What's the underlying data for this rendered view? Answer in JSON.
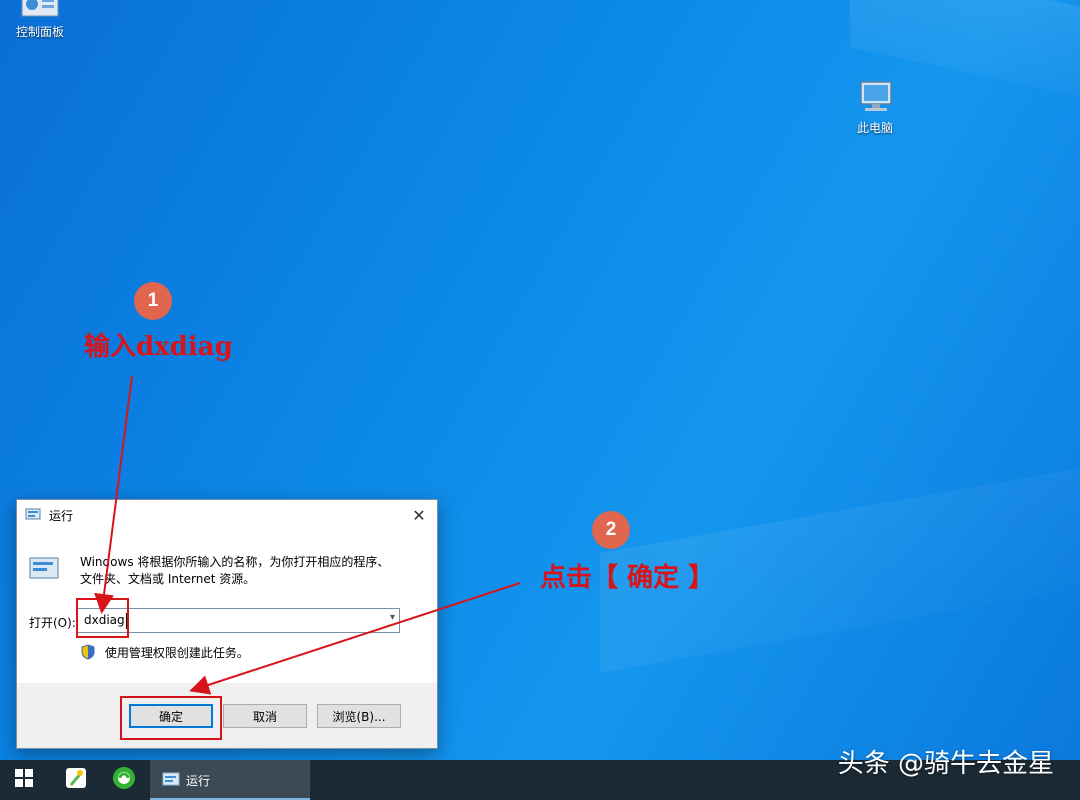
{
  "desktop": {
    "icons": [
      {
        "label": "控制面板",
        "icon": "control-panel-icon"
      },
      {
        "label": "此电脑",
        "icon": "computer-icon"
      }
    ]
  },
  "annotations": {
    "step1": {
      "badge": "1",
      "text": "输入dxdiag"
    },
    "step2": {
      "badge": "2",
      "text": "点击【 确定 】"
    },
    "color": "#d8141b",
    "badge_color": "#e0664e"
  },
  "run_dialog": {
    "title": "运行",
    "close_glyph": "✕",
    "description_line1": "Windows 将根据你所输入的名称，为你打开相应的程序、",
    "description_line2": "文件夹、文档或 Internet 资源。",
    "open_label": "打开(O):",
    "input_value": "dxdiag",
    "admin_note": "使用管理权限创建此任务。",
    "buttons": {
      "ok": "确定",
      "cancel": "取消",
      "browse": "浏览(B)..."
    }
  },
  "taskbar": {
    "start": "windows-start-icon",
    "apps": [
      "cleaner-app-icon",
      "browser-app-icon"
    ],
    "running_app_label": "运行",
    "background": "#1b2a35"
  },
  "watermark": "头条 @骑牛去金星"
}
